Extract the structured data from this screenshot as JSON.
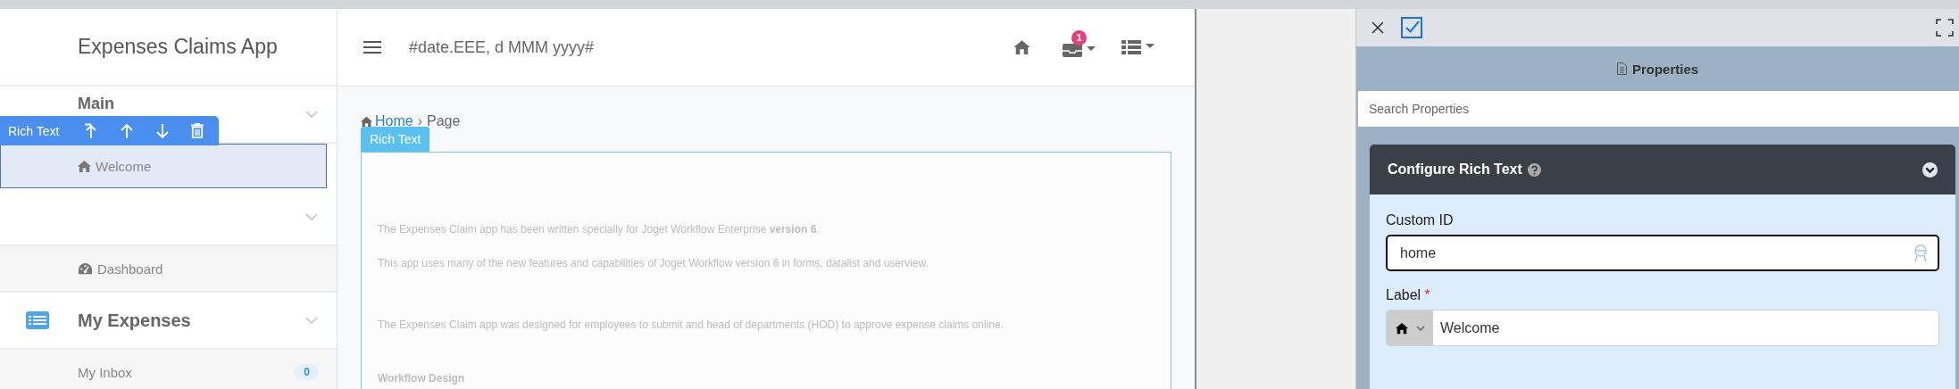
{
  "sidebar": {
    "app_title": "Expenses Claims App",
    "menu": [
      {
        "label": "Main",
        "kind": "plain",
        "items": [
          {
            "label": "Welcome",
            "kind": "home",
            "selected": true
          }
        ]
      },
      {
        "kind": "plain",
        "items": [
          {
            "label": "Dashboard",
            "kind": "dashboard",
            "selected": false
          }
        ]
      },
      {
        "label": "My Expenses",
        "kind": "list",
        "items": [
          {
            "label": "My Inbox",
            "kind": "plain",
            "badge": "0",
            "selected": false
          }
        ]
      }
    ]
  },
  "element_toolbar": {
    "label": "Rich Text"
  },
  "header": {
    "date_text": "#date.EEE, d MMM yyyy#",
    "inbox_badge": "1"
  },
  "content": {
    "breadcrumb": {
      "home": "Home",
      "separator": "›",
      "current": "Page"
    },
    "element_tag": "Rich Text",
    "blocks": [
      {
        "kind": "paragraph",
        "text": "The Expenses Claim app has been written specially for Joget Workflow Enterprise **version 6**."
      },
      {
        "kind": "paragraph",
        "text": "This app uses many of the new features and capabilities of Joget Workflow version 6 in forms, datalist and userview."
      },
      {
        "kind": "paragraph",
        "text": "The Expenses Claim app was designed for employees to submit and head of departments (HOD) to approve expense claims online."
      },
      {
        "kind": "heading",
        "text": "Workflow Design"
      }
    ]
  },
  "properties": {
    "title": "Properties",
    "search": {
      "placeholder": "Search Properties"
    },
    "section": {
      "title": "Configure Rich Text",
      "fields": [
        {
          "kind": "text",
          "label": "Custom ID",
          "value": "home",
          "focused": true
        },
        {
          "kind": "icon-text",
          "label": "Label",
          "required_mark": "*",
          "value": "Welcome",
          "focused": false
        }
      ]
    }
  }
}
